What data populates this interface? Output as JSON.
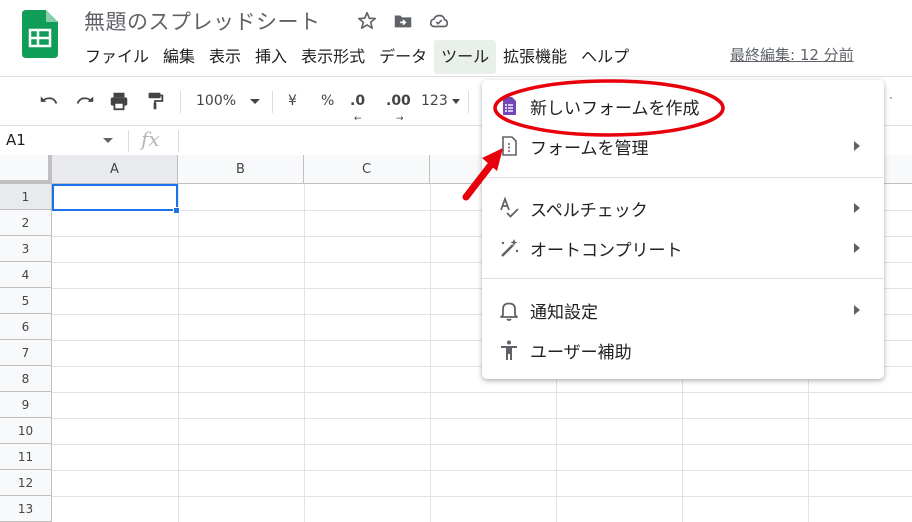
{
  "document": {
    "title": "無題のスプレッドシート",
    "last_edit": "最終編集: 12 分前"
  },
  "menubar": {
    "items": [
      "ファイル",
      "編集",
      "表示",
      "挿入",
      "表示形式",
      "データ",
      "ツール",
      "拡張機能",
      "ヘルプ"
    ],
    "active_index": 6
  },
  "toolbar": {
    "zoom": "100%",
    "currency": "¥",
    "percent": "%",
    "decimal_decrease": ".0",
    "decimal_increase": ".00",
    "more_formats": "123"
  },
  "formula_bar": {
    "name_box": "A1",
    "fx": "fx"
  },
  "grid": {
    "columns": [
      "A",
      "B",
      "C"
    ],
    "rows": [
      "1",
      "2",
      "3",
      "4",
      "5",
      "6",
      "7",
      "8",
      "9",
      "10",
      "11",
      "12",
      "13"
    ],
    "selected_cell": "A1"
  },
  "tools_menu": {
    "items": [
      {
        "label": "新しいフォームを作成",
        "icon": "forms-icon",
        "submenu": false
      },
      {
        "label": "フォームを管理",
        "icon": "manage-form-icon",
        "submenu": true
      },
      {
        "label": "スペルチェック",
        "icon": "spellcheck-icon",
        "submenu": true
      },
      {
        "label": "オートコンプリート",
        "icon": "magic-wand-icon",
        "submenu": true
      },
      {
        "label": "通知設定",
        "icon": "bell-icon",
        "submenu": true
      },
      {
        "label": "ユーザー補助",
        "icon": "accessibility-icon",
        "submenu": false
      }
    ]
  },
  "colors": {
    "brand_green": "#0f9d58",
    "forms_purple": "#7248b9",
    "selection_blue": "#1a73e8",
    "annotation_red": "#e8000b"
  }
}
